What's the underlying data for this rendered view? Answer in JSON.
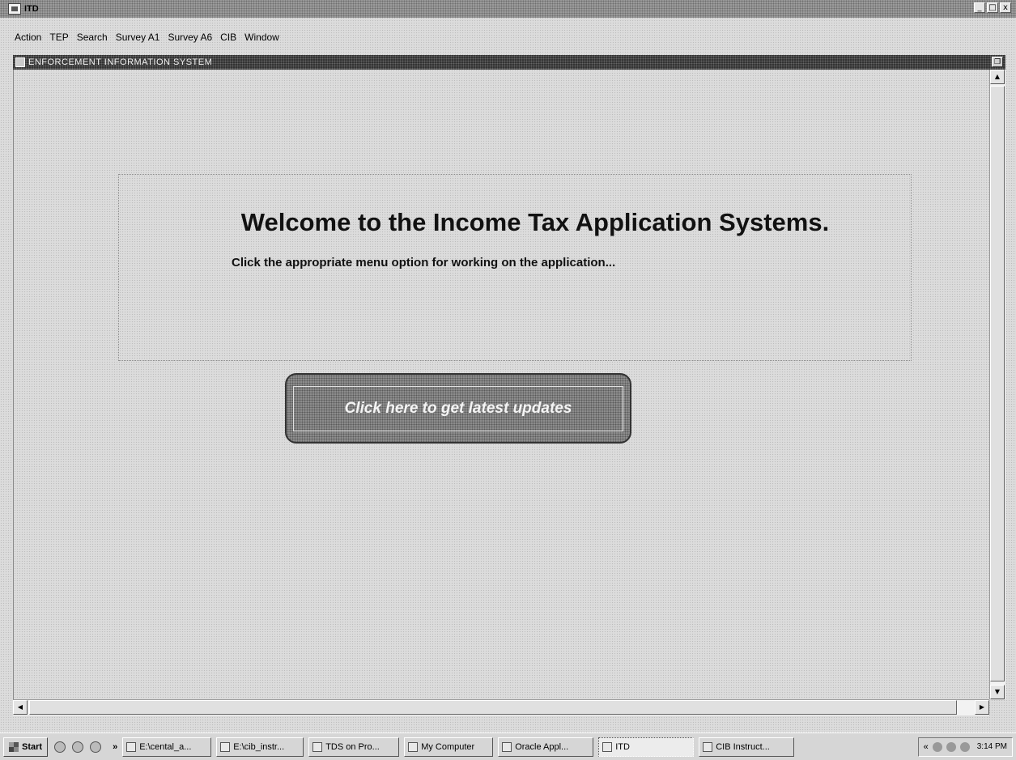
{
  "app": {
    "title": "ITD",
    "window_controls": {
      "minimize": "_",
      "restore": "□",
      "close": "x"
    }
  },
  "menu": [
    "Action",
    "TEP",
    "Search",
    "Survey A1",
    "Survey A6",
    "CIB",
    "Window"
  ],
  "mdi": {
    "title": "ENFORCEMENT INFORMATION SYSTEM"
  },
  "welcome": {
    "title": "Welcome to the Income Tax Application Systems.",
    "subtitle": "Click the appropriate menu option for working on the application..."
  },
  "updates_button": {
    "label": "Click here to get latest updates"
  },
  "taskbar": {
    "start": "Start",
    "overflow": "»",
    "tasks": [
      "E:\\cental_a...",
      "E:\\cib_instr...",
      "TDS on Pro...",
      "My Computer",
      "Oracle Appl...",
      "ITD",
      "CIB Instruct..."
    ],
    "tray_overflow": "«",
    "clock": "3:14 PM"
  }
}
